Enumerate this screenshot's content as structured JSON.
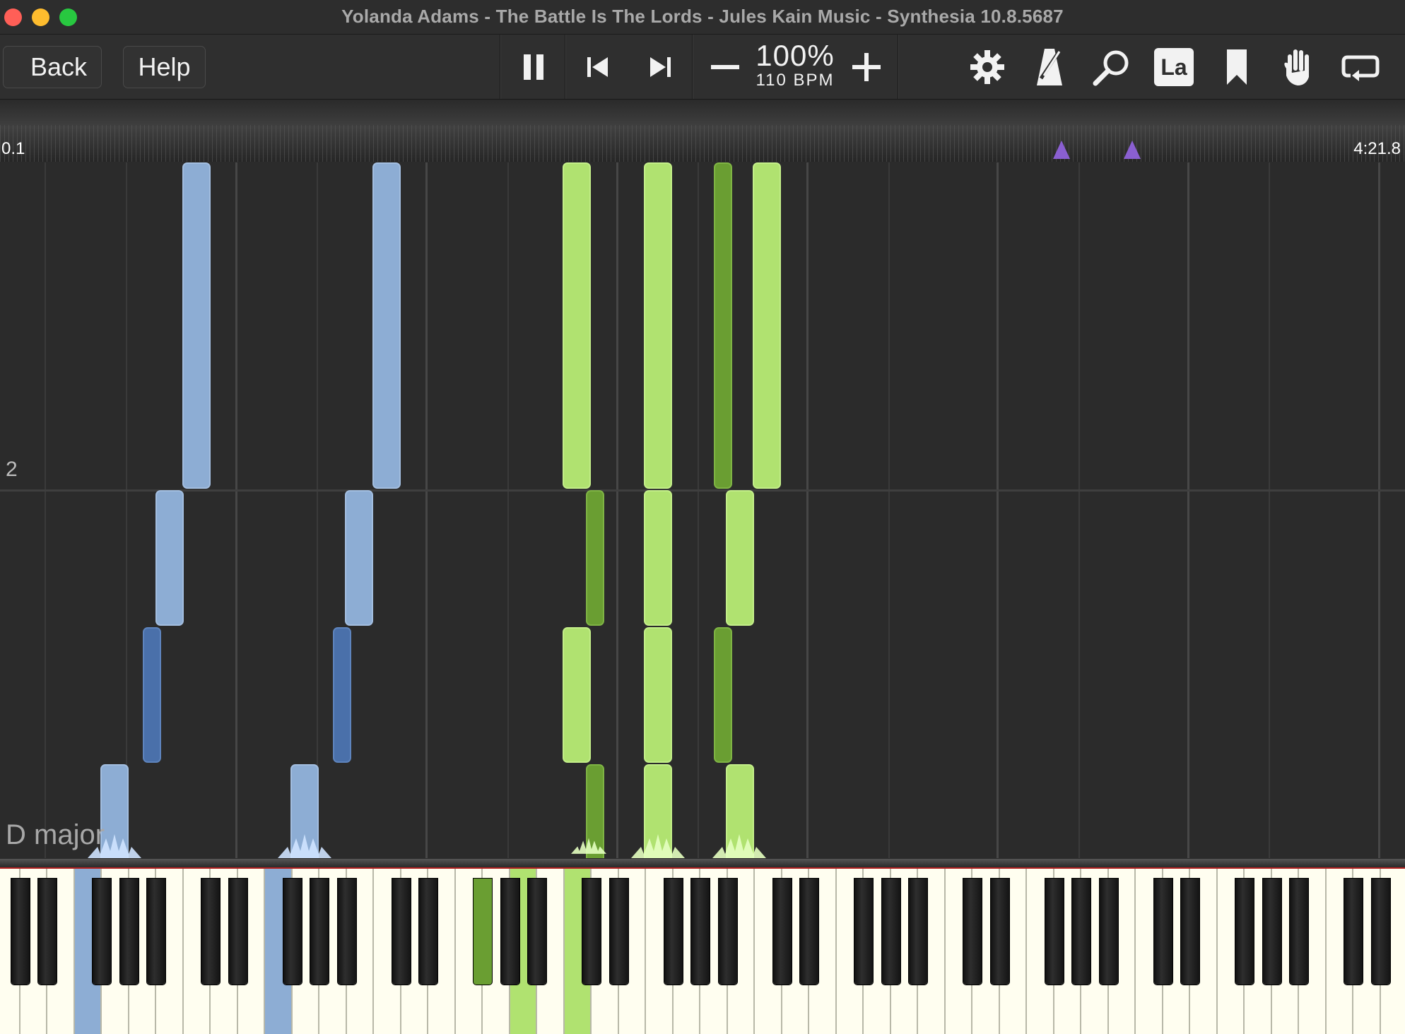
{
  "window": {
    "title": "Yolanda Adams - The Battle Is The Lords - Jules Kain Music - Synthesia 10.8.5687"
  },
  "toolbar": {
    "back_label": "Back",
    "help_label": "Help",
    "speed_percent": "100%",
    "tempo": "110 BPM",
    "icons": [
      "pause-icon",
      "skip-back-icon",
      "skip-forward-icon",
      "minus-icon",
      "plus-icon",
      "gear-icon",
      "metronome-icon",
      "magnifier-icon",
      "note-labels-icon",
      "bookmark-icon",
      "hand-icon",
      "loop-icon"
    ],
    "note_label_text": "La"
  },
  "timeline": {
    "start_time": "0.1",
    "end_time": "4:21.8",
    "bookmark_count": 2
  },
  "roll": {
    "measure_label": "2",
    "key_signature": "D major"
  },
  "colors": {
    "left_hand_light": "#8dadd4",
    "left_hand_dark": "#4a70aa",
    "right_hand_light": "#b0e270",
    "right_hand_dark": "#6a9e32",
    "bookmark": "#8a5fd1"
  }
}
